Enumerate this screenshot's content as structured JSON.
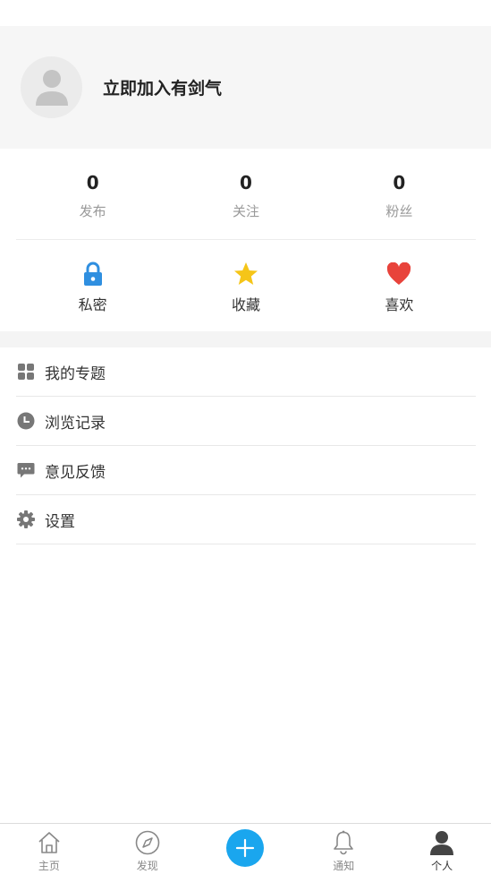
{
  "profile": {
    "name": "立即加入有剑气"
  },
  "stats": [
    {
      "value": "0",
      "label": "发布"
    },
    {
      "value": "0",
      "label": "关注"
    },
    {
      "value": "0",
      "label": "粉丝"
    }
  ],
  "quick_actions": [
    {
      "label": "私密",
      "icon": "lock-icon",
      "color": "#2f8fe0"
    },
    {
      "label": "收藏",
      "icon": "star-icon",
      "color": "#f5c518"
    },
    {
      "label": "喜欢",
      "icon": "heart-icon",
      "color": "#e8433b"
    }
  ],
  "menu": [
    {
      "label": "我的专题",
      "icon": "grid-icon"
    },
    {
      "label": "浏览记录",
      "icon": "clock-icon"
    },
    {
      "label": "意见反馈",
      "icon": "chat-icon"
    },
    {
      "label": "设置",
      "icon": "gear-icon"
    }
  ],
  "tab_bar": {
    "home": "主页",
    "discover": "发现",
    "notifications": "通知",
    "profile": "个人",
    "active": "profile",
    "accent_color": "#1aa6ee"
  }
}
